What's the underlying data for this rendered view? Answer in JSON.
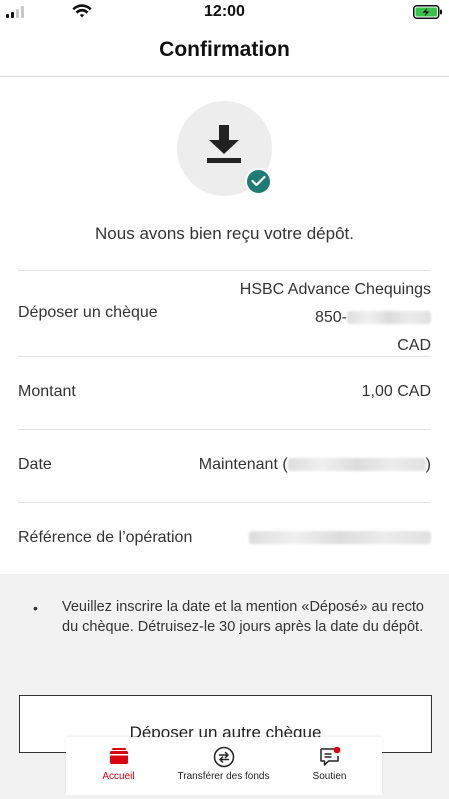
{
  "status_bar": {
    "time": "12:00"
  },
  "header": {
    "title": "Confirmation"
  },
  "confirmation": {
    "message": "Nous avons bien reçu votre dépôt."
  },
  "details": {
    "account": {
      "label": "Déposer un chèque",
      "account_name": "HSBC Advance Chequings",
      "account_number_prefix": "850-",
      "currency": "CAD"
    },
    "amount": {
      "label": "Montant",
      "value": "1,00 CAD"
    },
    "date": {
      "label": "Date",
      "value_prefix": "Maintenant (",
      "value_suffix": ")"
    },
    "reference": {
      "label": "Référence de l’opération"
    }
  },
  "notice": {
    "bullet": "•",
    "text": "Veuillez inscrire la date et la mention «Déposé» au recto du chèque. Détruisez-le 30 jours après la date du dépôt."
  },
  "actions": {
    "deposit_another_label": "Déposer un autre chèque"
  },
  "bottom_nav": {
    "items": [
      {
        "label": "Accueil",
        "icon": "wallet-icon",
        "active": true
      },
      {
        "label": "Transférer des fonds",
        "icon": "transfer-icon",
        "active": false
      },
      {
        "label": "Soutien",
        "icon": "chat-notification-icon",
        "active": false
      }
    ]
  },
  "colors": {
    "brand_red": "#db0011",
    "success_teal": "#1e7c74",
    "battery_green": "#3ac34a"
  }
}
